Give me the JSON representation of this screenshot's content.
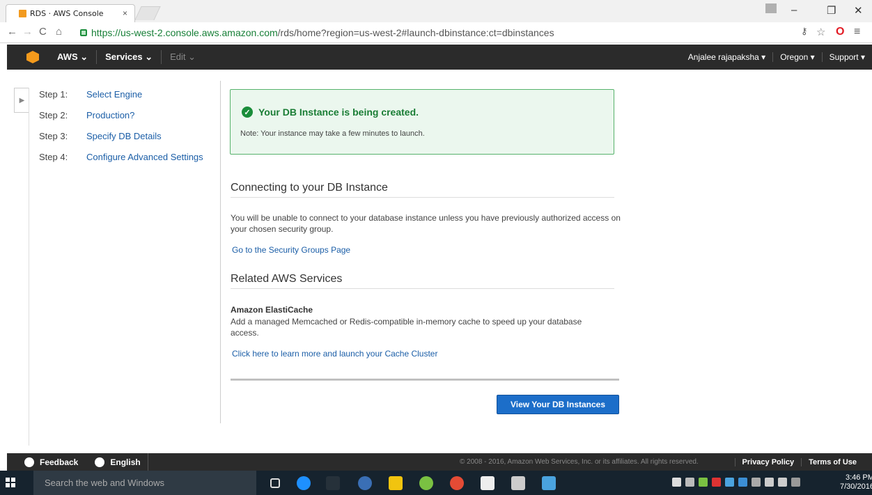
{
  "browser": {
    "tab_title": "RDS · AWS Console",
    "tab_close": "×",
    "url_host": "https://us-west-2.console.aws.amazon.com",
    "url_path": "/rds/home?region=us-west-2#launch-dbinstance:ct=dbinstances"
  },
  "aws_nav": {
    "aws_menu": "AWS ⌄",
    "services_menu": "Services ⌄",
    "edit_menu": "Edit ⌄",
    "user_menu": "Anjalee rajapaksha ▾",
    "region_menu": "Oregon ▾",
    "support_menu": "Support ▾"
  },
  "steps": [
    {
      "num": "Step 1:",
      "label": "Select Engine"
    },
    {
      "num": "Step 2:",
      "label": "Production?"
    },
    {
      "num": "Step 3:",
      "label": "Specify DB Details"
    },
    {
      "num": "Step 4:",
      "label": "Configure Advanced Settings"
    }
  ],
  "success": {
    "title": "Your DB Instance is being created.",
    "note": "Note: Your instance may take a few minutes to launch."
  },
  "connecting": {
    "heading": "Connecting to your DB Instance",
    "text": "You will be unable to connect to your database instance unless you have previously authorized access on your chosen security group.",
    "link": "Go to the Security Groups Page"
  },
  "related": {
    "heading": "Related AWS Services",
    "service_title": "Amazon ElastiCache",
    "service_text": "Add a managed Memcached or Redis-compatible in-memory cache to speed up your database access.",
    "link": "Click here to learn more and launch your Cache Cluster"
  },
  "actions": {
    "view_instances": "View Your DB Instances"
  },
  "footer": {
    "feedback": "Feedback",
    "language": "English",
    "copyright": "© 2008 - 2016, Amazon Web Services, Inc. or its affiliates. All rights reserved.",
    "privacy": "Privacy Policy",
    "terms": "Terms of Use"
  },
  "taskbar": {
    "search_placeholder": "Search the web and Windows",
    "time": "3:46 PM",
    "date": "7/30/2016"
  },
  "colors": {
    "aws_bar": "#2b2b2b",
    "success_border": "#56b26b",
    "success_text": "#1a7d35",
    "link": "#1b5ea7",
    "primary_button": "#1c6ec9"
  }
}
